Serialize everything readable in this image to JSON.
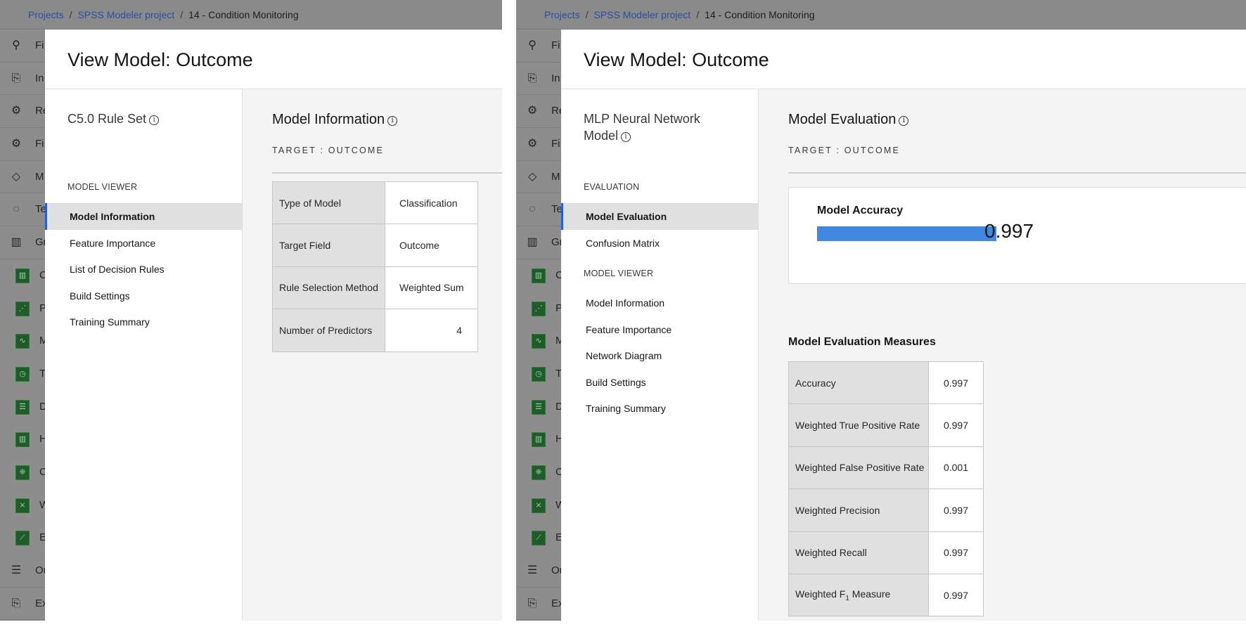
{
  "breadcrumb": {
    "projects": "Projects",
    "project": "SPSS Modeler project",
    "current": "14 - Condition Monitoring"
  },
  "sidebar": [
    {
      "icon": "search-icon",
      "glyph": "⚲",
      "label": "Fi",
      "sub": false
    },
    {
      "icon": "import-icon",
      "glyph": "⎘",
      "label": "In",
      "sub": false
    },
    {
      "icon": "record-ops-icon",
      "glyph": "⚙",
      "label": "Re",
      "sub": false
    },
    {
      "icon": "field-ops-icon",
      "glyph": "⚙",
      "label": "Fi",
      "sub": false
    },
    {
      "icon": "modeling-icon",
      "glyph": "◇",
      "label": "M",
      "sub": false
    },
    {
      "icon": "text-analytics-icon",
      "glyph": "◌",
      "label": "Te",
      "sub": false
    },
    {
      "icon": "graphs-icon",
      "glyph": "▥",
      "label": "Gr",
      "sub": false
    },
    {
      "icon": "chart-bar-icon",
      "glyph": "▥",
      "label": "C",
      "sub": true
    },
    {
      "icon": "chart-plot-icon",
      "glyph": "⋰",
      "label": "P",
      "sub": true
    },
    {
      "icon": "chart-multiplot-icon",
      "glyph": "∿",
      "label": "M",
      "sub": true
    },
    {
      "icon": "chart-time-plot-icon",
      "glyph": "◷",
      "label": "T",
      "sub": true
    },
    {
      "icon": "chart-distribution-icon",
      "glyph": "☰",
      "label": "D",
      "sub": true
    },
    {
      "icon": "chart-histogram-icon",
      "glyph": "▥",
      "label": "H",
      "sub": true
    },
    {
      "icon": "chart-collection-icon",
      "glyph": "❈",
      "label": "C",
      "sub": true
    },
    {
      "icon": "chart-web-icon",
      "glyph": "⨯",
      "label": "W",
      "sub": true
    },
    {
      "icon": "chart-evaluation-icon",
      "glyph": "⟋",
      "label": "E",
      "sub": true
    },
    {
      "icon": "outputs-icon",
      "glyph": "☰",
      "label": "Ou",
      "sub": false
    },
    {
      "icon": "export-icon",
      "glyph": "⎘",
      "label": "Ex",
      "sub": false
    }
  ],
  "left": {
    "title": "View Model: Outcome",
    "model_name": "C5.0 Rule Set",
    "sections": [
      {
        "label": "MODEL VIEWER",
        "items": [
          "Model Information",
          "Feature Importance",
          "List of Decision Rules",
          "Build Settings",
          "Training Summary"
        ]
      }
    ],
    "active": "Model Information",
    "content_title": "Model Information",
    "target": "TARGET : OUTCOME",
    "table": [
      [
        "Type of Model",
        "Classification"
      ],
      [
        "Target Field",
        "Outcome"
      ],
      [
        "Rule Selection Method",
        "Weighted Sum"
      ],
      [
        "Number of Predictors",
        "4"
      ]
    ]
  },
  "right": {
    "title": "View Model: Outcome",
    "model_name_line1": "MLP Neural Network",
    "model_name_line2": "Model",
    "sections": [
      {
        "label": "EVALUATION",
        "items": [
          "Model Evaluation",
          "Confusion Matrix"
        ]
      },
      {
        "label": "MODEL VIEWER",
        "items": [
          "Model Information",
          "Feature Importance",
          "Network Diagram",
          "Build Settings",
          "Training Summary"
        ]
      }
    ],
    "active": "Model Evaluation",
    "content_title": "Model Evaluation",
    "target": "TARGET : OUTCOME",
    "accuracy": {
      "label": "Model Accuracy",
      "value": "0.997",
      "fraction": 0.997,
      "bar_color": "#4189e0"
    },
    "measures_title": "Model Evaluation Measures",
    "measures": [
      [
        "Accuracy",
        "0.997"
      ],
      [
        "Weighted True Positive Rate",
        "0.997"
      ],
      [
        "Weighted False Positive Rate",
        "0.001"
      ],
      [
        "Weighted Precision",
        "0.997"
      ],
      [
        "Weighted Recall",
        "0.997"
      ],
      [
        "Weighted F",
        "1",
        " Measure",
        "0.997"
      ]
    ]
  },
  "colors": {
    "accent": "#0f62fe",
    "overlay": "#8d8d8d",
    "link": "#2a4fa8"
  }
}
